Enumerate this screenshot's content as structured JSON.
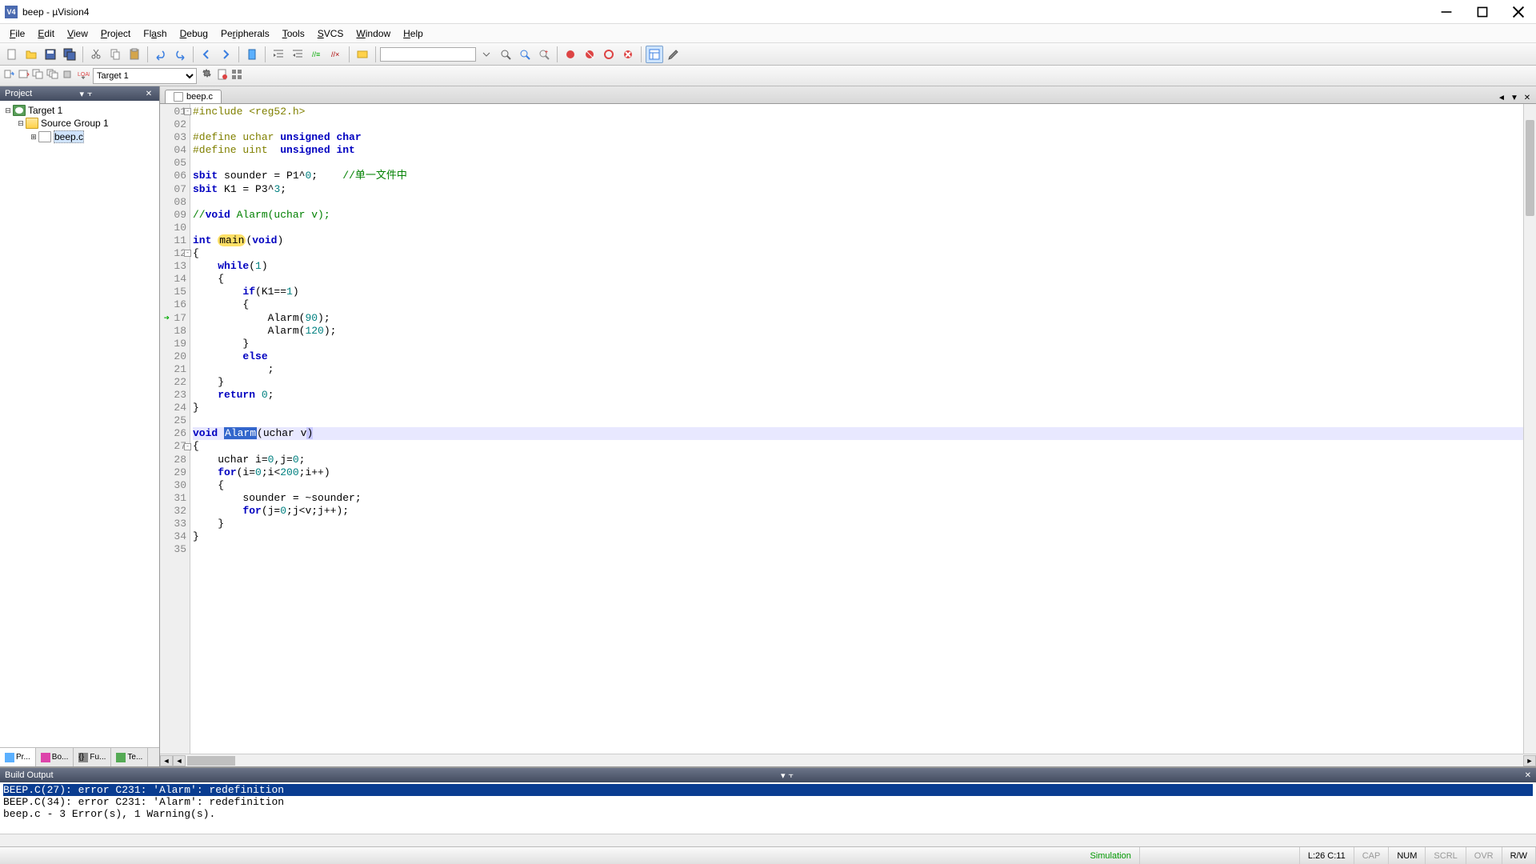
{
  "window": {
    "title": "beep - µVision4"
  },
  "menu": {
    "file": "File",
    "edit": "Edit",
    "view": "View",
    "project": "Project",
    "flash": "Flash",
    "debug": "Debug",
    "peripherals": "Peripherals",
    "tools": "Tools",
    "svcs": "SVCS",
    "window": "Window",
    "help": "Help"
  },
  "toolbar2": {
    "target_selected": "Target 1"
  },
  "project_panel": {
    "title": "Project",
    "root": "Target 1",
    "group": "Source Group 1",
    "file": "beep.c"
  },
  "project_tabs": {
    "t1": "Pr...",
    "t2": "Bo...",
    "t3": "Fu...",
    "t4": "Te..."
  },
  "editor": {
    "tab": "beep.c",
    "lines": [
      {
        "n": "01",
        "raw": "#include <reg52.h>"
      },
      {
        "n": "02",
        "raw": ""
      },
      {
        "n": "03",
        "raw": "#define uchar unsigned char"
      },
      {
        "n": "04",
        "raw": "#define uint  unsigned int"
      },
      {
        "n": "05",
        "raw": ""
      },
      {
        "n": "06",
        "raw": "sbit sounder = P1^0;    //单一文件中"
      },
      {
        "n": "07",
        "raw": "sbit K1 = P3^3;"
      },
      {
        "n": "08",
        "raw": ""
      },
      {
        "n": "09",
        "raw": "//void Alarm(uchar v);"
      },
      {
        "n": "10",
        "raw": ""
      },
      {
        "n": "11",
        "raw": "int main(void)"
      },
      {
        "n": "12",
        "raw": "{"
      },
      {
        "n": "13",
        "raw": "    while(1)"
      },
      {
        "n": "14",
        "raw": "    {"
      },
      {
        "n": "15",
        "raw": "        if(K1==1)"
      },
      {
        "n": "16",
        "raw": "        {"
      },
      {
        "n": "17",
        "raw": "            Alarm(90);"
      },
      {
        "n": "18",
        "raw": "            Alarm(120);"
      },
      {
        "n": "19",
        "raw": "        }"
      },
      {
        "n": "20",
        "raw": "        else"
      },
      {
        "n": "21",
        "raw": "            ;"
      },
      {
        "n": "22",
        "raw": "    }"
      },
      {
        "n": "23",
        "raw": "    return 0;"
      },
      {
        "n": "24",
        "raw": "}"
      },
      {
        "n": "25",
        "raw": ""
      },
      {
        "n": "26",
        "raw": "void Alarm(uchar v)"
      },
      {
        "n": "27",
        "raw": "{"
      },
      {
        "n": "28",
        "raw": "    uchar i=0,j=0;"
      },
      {
        "n": "29",
        "raw": "    for(i=0;i<200;i++)"
      },
      {
        "n": "30",
        "raw": "    {"
      },
      {
        "n": "31",
        "raw": "        sounder = ~sounder;"
      },
      {
        "n": "32",
        "raw": "        for(j=0;j<v;j++);"
      },
      {
        "n": "33",
        "raw": "    }"
      },
      {
        "n": "34",
        "raw": "}"
      },
      {
        "n": "35",
        "raw": ""
      }
    ]
  },
  "build_output": {
    "title": "Build Output",
    "lines": [
      "BEEP.C(27): error C231: 'Alarm': redefinition",
      "BEEP.C(34): error C231: 'Alarm': redefinition",
      "beep.c - 3 Error(s), 1 Warning(s)."
    ]
  },
  "statusbar": {
    "sim": "Simulation",
    "pos": "L:26 C:11",
    "cap": "CAP",
    "num": "NUM",
    "scrl": "SCRL",
    "ovr": "OVR",
    "rw": "R/W"
  }
}
